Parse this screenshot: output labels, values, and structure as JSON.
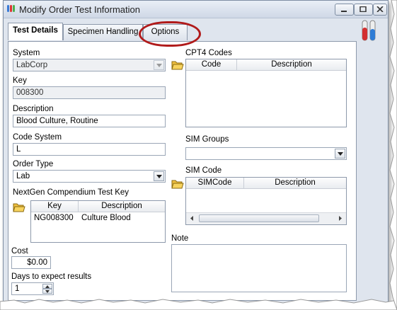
{
  "window": {
    "title": "Modify Order Test Information"
  },
  "tabs": [
    {
      "label": "Test Details",
      "active": true
    },
    {
      "label": "Specimen Handling",
      "active": false
    },
    {
      "label": "Options",
      "active": false
    }
  ],
  "form": {
    "system_label": "System",
    "system_value": "LabCorp",
    "key_label": "Key",
    "key_value": "008300",
    "description_label": "Description",
    "description_value": "Blood Culture, Routine",
    "code_system_label": "Code System",
    "code_system_value": "L",
    "order_type_label": "Order Type",
    "order_type_value": "Lab",
    "compendium_label": "NextGen Compendium Test Key",
    "compendium_headers": [
      "Key",
      "Description"
    ],
    "compendium_rows": [
      {
        "key": "NG008300",
        "description": "Culture Blood"
      }
    ],
    "cost_label": "Cost",
    "cost_value": "$0.00",
    "days_label": "Days to expect results",
    "days_value": "1"
  },
  "right": {
    "cpt4_label": "CPT4 Codes",
    "cpt4_headers": [
      "Code",
      "Description"
    ],
    "sim_groups_label": "SIM Groups",
    "sim_groups_value": "",
    "sim_code_label": "SIM Code",
    "sim_code_headers": [
      "SIMCode",
      "Description"
    ],
    "note_label": "Note",
    "note_value": ""
  },
  "icons": {
    "app": "test-tubes-icon",
    "brand": "test-tubes-logo",
    "folder": "open-folder-icon"
  },
  "colors": {
    "highlight_ring": "#b01a1a",
    "window_bg": "#dfe5ee"
  }
}
